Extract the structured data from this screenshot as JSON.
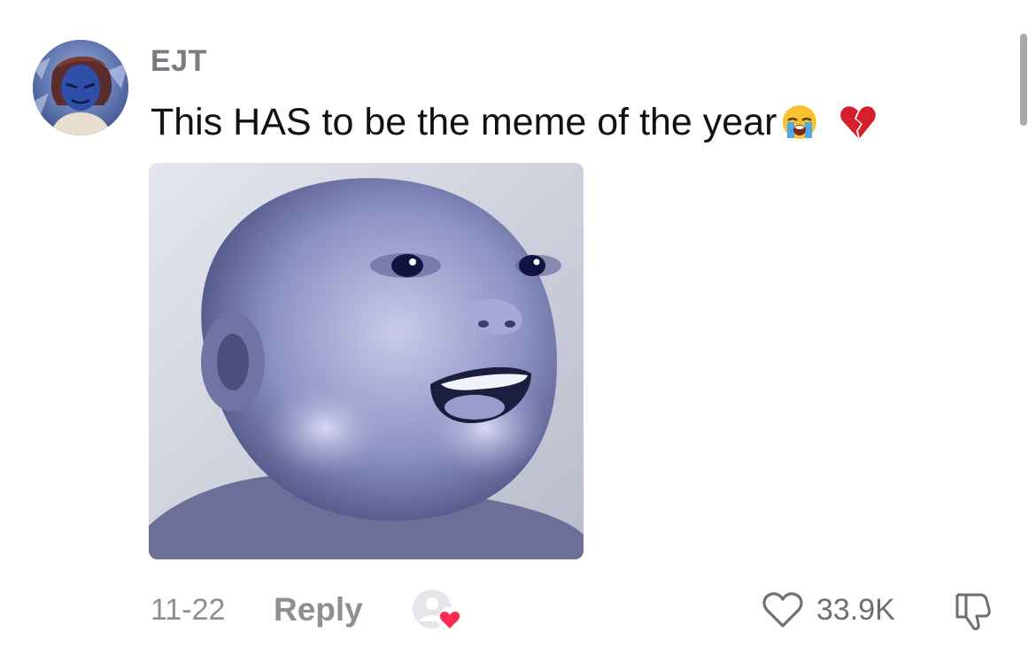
{
  "comment": {
    "username": "EJT",
    "text": "This HAS to be the meme of the year",
    "emojis": [
      "loudly-crying-face-emoji",
      "broken-heart-emoji"
    ],
    "date": "11-22",
    "reply_label": "Reply",
    "like_count": "33.9K"
  },
  "icons": {
    "like": "heart-outline-icon",
    "dislike": "thumbs-down-outline-icon",
    "creator_liked": "creator-liked-heart-icon"
  },
  "colors": {
    "text_primary": "#111111",
    "text_secondary": "#8e8e93",
    "like_count": "#6e6e73",
    "creator_heart": "#fe2c55",
    "scrollbar": "#a9a9ad"
  }
}
